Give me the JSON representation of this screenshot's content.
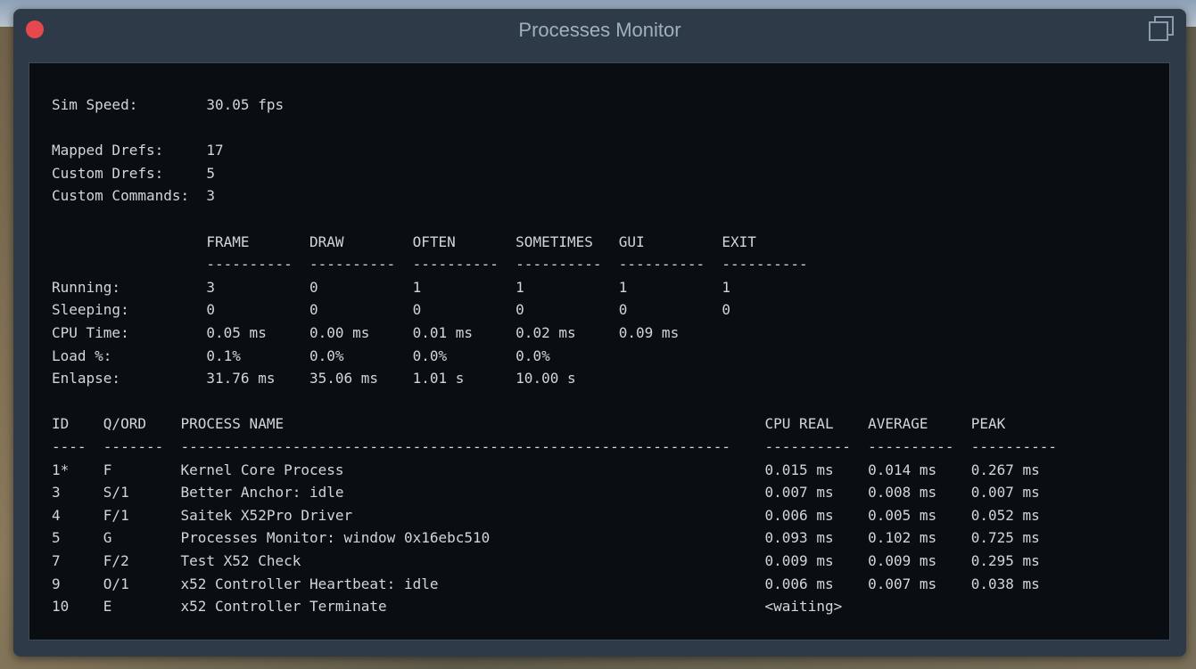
{
  "window": {
    "title": "Processes Monitor"
  },
  "monitor": {
    "sim_speed_label": "Sim Speed:",
    "sim_speed_value": "30.05 fps",
    "mapped_drefs_label": "Mapped Drefs:",
    "mapped_drefs_value": "17",
    "custom_drefs_label": "Custom Drefs:",
    "custom_drefs_value": "5",
    "custom_commands_label": "Custom Commands:",
    "custom_commands_value": "3"
  },
  "phase_table": {
    "columns": [
      "FRAME",
      "DRAW",
      "OFTEN",
      "SOMETIMES",
      "GUI",
      "EXIT"
    ],
    "separator": "----------",
    "rows": [
      {
        "label": "Running:",
        "values": [
          "3",
          "0",
          "1",
          "1",
          "1",
          "1"
        ]
      },
      {
        "label": "Sleeping:",
        "values": [
          "0",
          "0",
          "0",
          "0",
          "0",
          "0"
        ]
      },
      {
        "label": "CPU Time:",
        "values": [
          "0.05 ms",
          "0.00 ms",
          "0.01 ms",
          "0.02 ms",
          "0.09 ms",
          ""
        ]
      },
      {
        "label": "Load %:",
        "values": [
          "0.1%",
          "0.0%",
          "0.0%",
          "0.0%",
          "",
          ""
        ]
      },
      {
        "label": "Enlapse:",
        "values": [
          "31.76 ms",
          "35.06 ms",
          "1.01 s",
          "10.00 s",
          "",
          ""
        ]
      }
    ]
  },
  "process_table": {
    "columns": [
      "ID",
      "Q/ORD",
      "PROCESS NAME",
      "CPU REAL",
      "AVERAGE",
      "PEAK"
    ],
    "separators": [
      "----",
      "-------",
      "----------------------------------------------------------------",
      "----------",
      "----------",
      "----------"
    ],
    "rows": [
      {
        "id": "1*",
        "qord": "F",
        "name": "Kernel Core Process",
        "cpu_real": "0.015 ms",
        "average": "0.014 ms",
        "peak": "0.267 ms"
      },
      {
        "id": "3",
        "qord": "S/1",
        "name": "Better Anchor: idle",
        "cpu_real": "0.007 ms",
        "average": "0.008 ms",
        "peak": "0.007 ms"
      },
      {
        "id": "4",
        "qord": "F/1",
        "name": "Saitek X52Pro Driver",
        "cpu_real": "0.006 ms",
        "average": "0.005 ms",
        "peak": "0.052 ms"
      },
      {
        "id": "5",
        "qord": "G",
        "name": "Processes Monitor: window 0x16ebc510",
        "cpu_real": "0.093 ms",
        "average": "0.102 ms",
        "peak": "0.725 ms"
      },
      {
        "id": "7",
        "qord": "F/2",
        "name": "Test X52 Check",
        "cpu_real": "0.009 ms",
        "average": "0.009 ms",
        "peak": "0.295 ms"
      },
      {
        "id": "9",
        "qord": "O/1",
        "name": "x52 Controller Heartbeat: idle",
        "cpu_real": "0.006 ms",
        "average": "0.007 ms",
        "peak": "0.038 ms"
      },
      {
        "id": "10",
        "qord": "E",
        "name": "x52 Controller Terminate",
        "cpu_real": "<waiting>",
        "average": "",
        "peak": ""
      }
    ]
  }
}
